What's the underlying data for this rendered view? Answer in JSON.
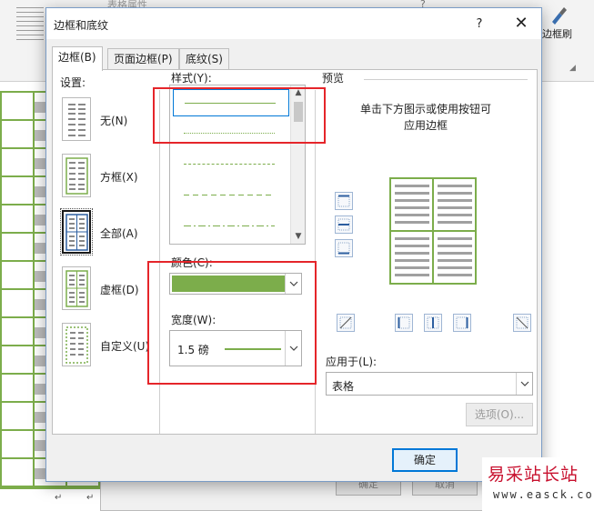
{
  "background": {
    "ribbon_menu": "表格属性",
    "ribbon_help": "?",
    "format_brush_label": "边框刷",
    "table_marker": "↵",
    "behind_buttons": [
      "确定",
      "取消"
    ]
  },
  "dialog": {
    "title": "边框和底纹",
    "help": "?",
    "close": "✕",
    "tabs": [
      {
        "label": "边框(B)",
        "active": true
      },
      {
        "label": "页面边框(P)",
        "active": false
      },
      {
        "label": "底纹(S)",
        "active": false
      }
    ],
    "settings": {
      "label": "设置:",
      "items": [
        {
          "label": "无(N)",
          "icon": "setting-none-icon"
        },
        {
          "label": "方框(X)",
          "icon": "setting-box-icon"
        },
        {
          "label": "全部(A)",
          "icon": "setting-all-icon",
          "selected": true
        },
        {
          "label": "虚框(D)",
          "icon": "setting-grid-icon"
        },
        {
          "label": "自定义(U)",
          "icon": "setting-custom-icon"
        }
      ]
    },
    "style": {
      "label": "样式(Y):",
      "options": [
        "solid",
        "dotted",
        "dashed-small",
        "dashed",
        "dash-dot"
      ],
      "selected_index": 0
    },
    "color": {
      "label": "颜色(C):",
      "value": "#7cad4b"
    },
    "width": {
      "label": "宽度(W):",
      "value": "1.5 磅"
    },
    "preview": {
      "label": "预览",
      "hint_line1": "单击下方图示或使用按钮可",
      "hint_line2": "应用边框"
    },
    "apply_to": {
      "label": "应用于(L):",
      "value": "表格"
    },
    "options_button": "选项(O)...",
    "ok_button": "确定"
  },
  "watermark": {
    "title": "易采站长站",
    "url": "www.easck.com"
  },
  "colors": {
    "border_green": "#7cad4b",
    "highlight_red": "#e5252a",
    "accent_blue": "#0078d7"
  }
}
